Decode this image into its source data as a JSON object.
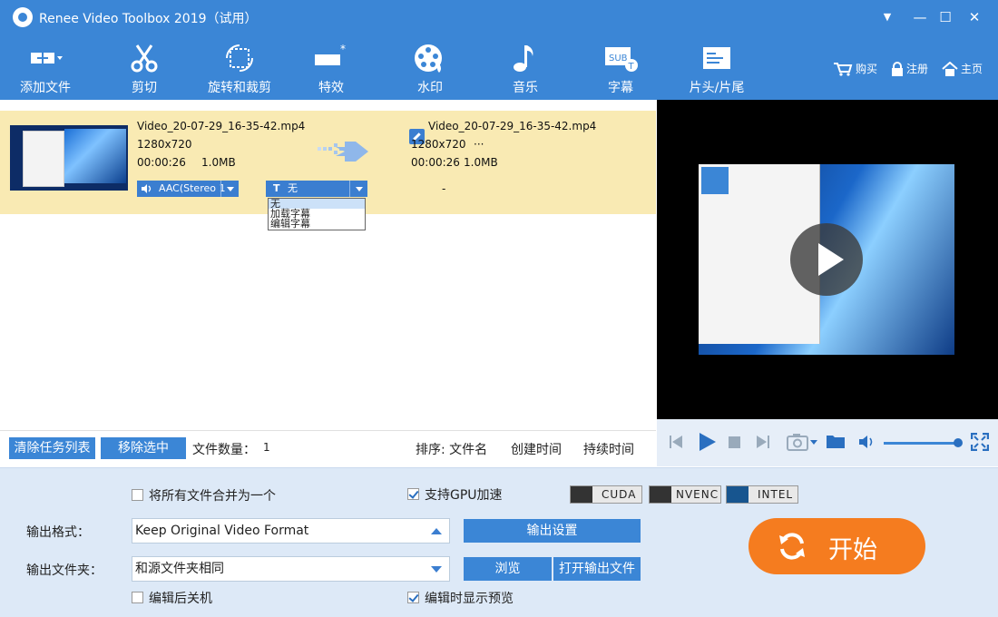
{
  "window": {
    "title": "Renee Video Toolbox 2019（试用）",
    "controls": [
      "▼",
      "—",
      "☐",
      "✕"
    ]
  },
  "toolbar": {
    "items": [
      {
        "label": "添加文件",
        "icon": "add-file-icon"
      },
      {
        "label": "剪切",
        "icon": "scissors-icon"
      },
      {
        "label": "旋转和裁剪",
        "icon": "rotate-crop-icon"
      },
      {
        "label": "特效",
        "icon": "effects-icon"
      },
      {
        "label": "水印",
        "icon": "watermark-icon"
      },
      {
        "label": "音乐",
        "icon": "music-icon"
      },
      {
        "label": "字幕",
        "icon": "subtitle-icon"
      },
      {
        "label": "片头/片尾",
        "icon": "intro-outro-icon"
      }
    ],
    "links": {
      "buy": "购买",
      "register": "注册",
      "home": "主页"
    }
  },
  "task": {
    "source": {
      "filename": "Video_20-07-29_16-35-42.mp4",
      "resolution": "1280x720",
      "duration": "00:00:26",
      "size": "1.0MB"
    },
    "output": {
      "filename": "Video_20-07-29_16-35-42.mp4",
      "resolution": "1280x720",
      "ellipsis": "···",
      "duration": "00:00:26",
      "size": "1.0MB"
    },
    "audio_track": "AAC(Stereo 1",
    "subtitle": {
      "selected": "无",
      "options": [
        "无",
        "加载字幕",
        "编辑字幕"
      ]
    },
    "dash": "-"
  },
  "list_footer": {
    "clear_label": "清除任务列表",
    "remove_label": "移除选中",
    "count_label": "文件数量：",
    "count_value": "1",
    "sort_label": "排序: 文件名",
    "sort_created": "创建时间",
    "sort_duration": "持续时间"
  },
  "settings": {
    "merge_label": "将所有文件合并为一个",
    "merge_checked": false,
    "gpu_label": "支持GPU加速",
    "gpu_checked": true,
    "gpu_badges": [
      "CUDA",
      "NVENC",
      "INTEL"
    ],
    "format_label": "输出格式：",
    "format_value": "Keep Original Video Format",
    "output_settings_label": "输出设置",
    "folder_label": "输出文件夹：",
    "folder_value": "和源文件夹相同",
    "browse_label": "浏览",
    "open_folder_label": "打开输出文件",
    "shutdown_label": "编辑后关机",
    "shutdown_checked": false,
    "preview_label": "编辑时显示预览",
    "preview_checked": true,
    "start_label": "开始"
  },
  "colors": {
    "accent": "#3b86d6",
    "start": "#f57c1f",
    "selected_row": "#f9eab3"
  }
}
